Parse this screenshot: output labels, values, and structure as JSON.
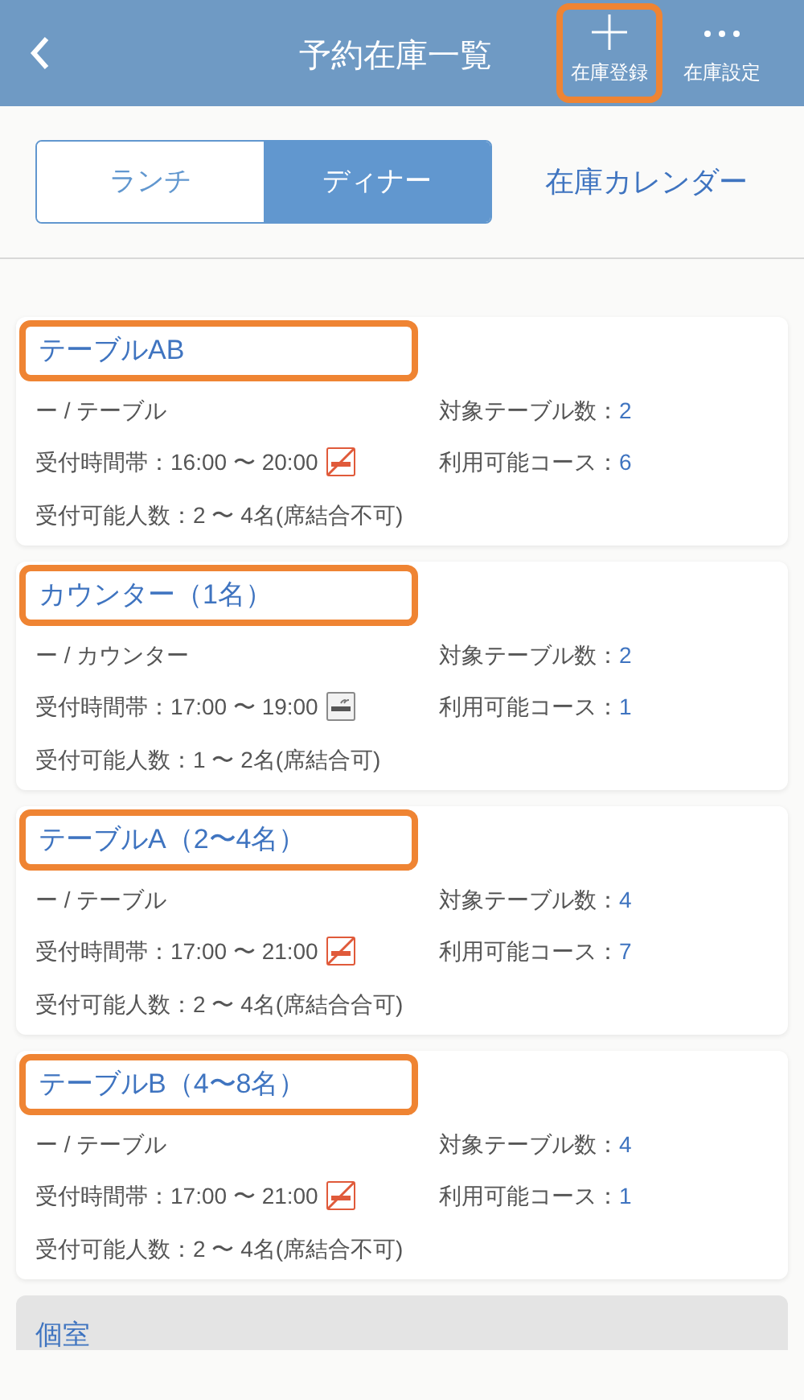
{
  "header": {
    "title": "予約在庫一覧",
    "actions": [
      {
        "label": "在庫登録",
        "kind": "plus",
        "highlighted": true
      },
      {
        "label": "在庫設定",
        "kind": "dots",
        "highlighted": false
      }
    ]
  },
  "tabs": [
    {
      "label": "ランチ",
      "selected": false
    },
    {
      "label": "ディナー",
      "selected": true
    }
  ],
  "calendar_link": "在庫カレンダー",
  "cards": [
    {
      "title": "テーブルAB",
      "highlighted": true,
      "category": "ー / テーブル",
      "tables_label": "対象テーブル数：",
      "tables": "2",
      "time": "受付時間帯：16:00 〜 20:00",
      "smoking_allowed": false,
      "courses_label": "利用可能コース：",
      "courses": "6",
      "capacity": "受付可能人数：2 〜 4名(席結合不可)"
    },
    {
      "title": "カウンター（1名）",
      "highlighted": true,
      "category": "ー / カウンター",
      "tables_label": "対象テーブル数：",
      "tables": "2",
      "time": "受付時間帯：17:00 〜 19:00",
      "smoking_allowed": true,
      "courses_label": "利用可能コース：",
      "courses": "1",
      "capacity": "受付可能人数：1 〜 2名(席結合可)"
    },
    {
      "title": "テーブルA（2〜4名）",
      "highlighted": true,
      "category": "ー / テーブル",
      "tables_label": "対象テーブル数：",
      "tables": "4",
      "time": "受付時間帯：17:00 〜 21:00",
      "smoking_allowed": false,
      "courses_label": "利用可能コース：",
      "courses": "7",
      "capacity": "受付可能人数：2 〜 4名(席結合合可)"
    },
    {
      "title": "テーブルB（4〜8名）",
      "highlighted": true,
      "category": "ー / テーブル",
      "tables_label": "対象テーブル数：",
      "tables": "4",
      "time": "受付時間帯：17:00 〜 21:00",
      "smoking_allowed": false,
      "courses_label": "利用可能コース：",
      "courses": "1",
      "capacity": "受付可能人数：2 〜 4名(席結合不可)"
    }
  ],
  "section": {
    "title": "個室"
  }
}
